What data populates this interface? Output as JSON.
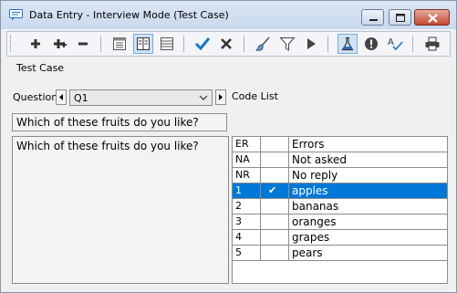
{
  "window": {
    "title": "Data Entry - Interview Mode (Test Case)",
    "icons": {
      "app": "speech-bubble-icon"
    }
  },
  "toolbar": {
    "buttons": [
      {
        "name": "add-button",
        "icon": "plus-icon"
      },
      {
        "name": "add-multiple-button",
        "icon": "plus-cross-icon"
      },
      {
        "name": "delete-button",
        "icon": "minus-icon"
      },
      {
        "name": "layout-1-button",
        "icon": "layout-rows-icon"
      },
      {
        "name": "layout-2-button",
        "icon": "layout-columns-icon"
      },
      {
        "name": "layout-3-button",
        "icon": "layout-list-icon"
      },
      {
        "name": "accept-button",
        "icon": "check-icon"
      },
      {
        "name": "cancel-button",
        "icon": "x-icon"
      },
      {
        "name": "brush-button",
        "icon": "brush-icon"
      },
      {
        "name": "filter-button",
        "icon": "filter-icon"
      },
      {
        "name": "run-button",
        "icon": "play-icon"
      },
      {
        "name": "test-button",
        "icon": "flask-icon"
      },
      {
        "name": "alert-button",
        "icon": "exclamation-icon"
      },
      {
        "name": "spell-button",
        "icon": "spellcheck-icon"
      },
      {
        "name": "print-button",
        "icon": "printer-icon"
      }
    ]
  },
  "case_label": "Test Case",
  "question": {
    "label": "Question",
    "value": "Q1",
    "text": "Which of these fruits do you like?"
  },
  "code_list": {
    "label": "Code List",
    "rows": [
      {
        "code": "ER",
        "check": "",
        "label": "Errors",
        "selected": false
      },
      {
        "code": "NA",
        "check": "",
        "label": "Not asked",
        "selected": false
      },
      {
        "code": "NR",
        "check": "",
        "label": "No reply",
        "selected": false
      },
      {
        "code": "1",
        "check": "✔",
        "label": "apples",
        "selected": true
      },
      {
        "code": "2",
        "check": "",
        "label": "bananas",
        "selected": false
      },
      {
        "code": "3",
        "check": "",
        "label": "oranges",
        "selected": false
      },
      {
        "code": "4",
        "check": "",
        "label": "grapes",
        "selected": false
      },
      {
        "code": "5",
        "check": "",
        "label": "pears",
        "selected": false
      }
    ]
  },
  "colors": {
    "selection": "#0078d7",
    "accent": "#1f75c7"
  }
}
